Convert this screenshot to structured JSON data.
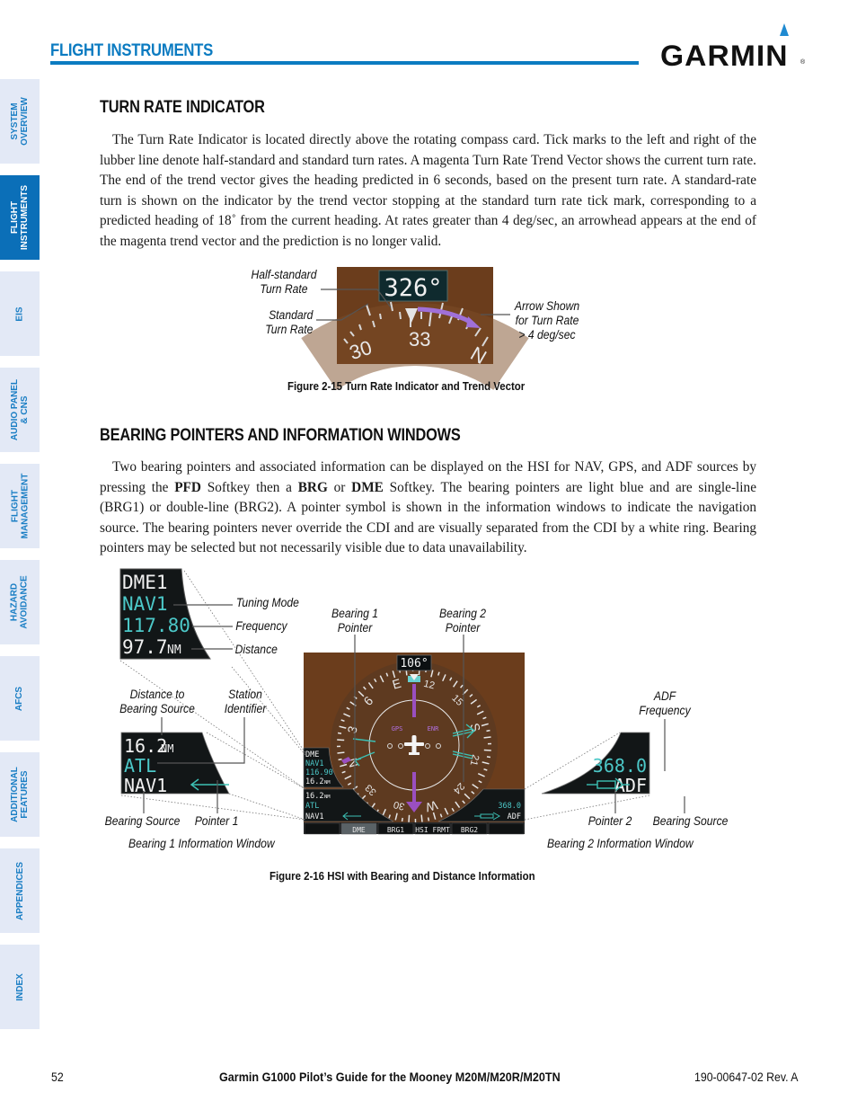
{
  "header": {
    "section_title": "FLIGHT INSTRUMENTS",
    "logo": "GARMIN",
    "logo_mark": "®",
    "accent_color": "#0b7bc1"
  },
  "side_tabs": [
    {
      "label": "SYSTEM\nOVERVIEW",
      "active": false
    },
    {
      "label": "FLIGHT\nINSTRUMENTS",
      "active": true
    },
    {
      "label": "EIS",
      "active": false
    },
    {
      "label": "AUDIO PANEL\n& CNS",
      "active": false
    },
    {
      "label": "FLIGHT\nMANAGEMENT",
      "active": false
    },
    {
      "label": "HAZARD\nAVOIDANCE",
      "active": false
    },
    {
      "label": "AFCS",
      "active": false
    },
    {
      "label": "ADDITIONAL\nFEATURES",
      "active": false
    },
    {
      "label": "APPENDICES",
      "active": false
    },
    {
      "label": "INDEX",
      "active": false
    }
  ],
  "section1": {
    "heading": "TURN RATE INDICATOR",
    "body": "The Turn Rate Indicator is located directly above the rotating compass card.  Tick marks to the left and right of the lubber line denote half-standard and standard turn rates.  A magenta Turn Rate Trend Vector shows the current turn rate.  The end of the trend vector gives the heading predicted in 6 seconds, based on the present turn rate.  A standard-rate turn is shown on the indicator by the trend vector stopping at the standard turn rate tick mark, corresponding to a predicted heading of 18˚ from the current heading.  At rates greater than 4 deg/sec, an arrowhead appears at the end of the magenta trend vector and the prediction is no longer valid.",
    "figure": {
      "caption": "Figure 2-15  Turn Rate Indicator and Trend Vector",
      "heading_readout": "326°",
      "card_labels": [
        "30",
        "33",
        "N"
      ],
      "callouts": {
        "half_standard_1": "Half-standard",
        "half_standard_2": "Turn Rate",
        "standard_1": "Standard",
        "standard_2": "Turn Rate",
        "arrow_1": "Arrow Shown",
        "arrow_2": "for Turn Rate",
        "arrow_3": "> 4 deg/sec"
      }
    }
  },
  "section2": {
    "heading": "BEARING POINTERS AND INFORMATION WINDOWS",
    "body_parts": {
      "p1": "Two bearing pointers and associated information can be displayed on the HSI for NAV, GPS, and ADF sources by pressing the ",
      "b1": "PFD",
      "p2": " Softkey then a ",
      "b2": "BRG",
      "p3": " or ",
      "b3": "DME",
      "p4": " Softkey.  The bearing pointers are light blue and are single-line (BRG1) or double-line (BRG2).  A pointer symbol is shown in the information windows to indicate the navigation source.  The bearing pointers never override the CDI and are visually separated from the CDI by a white ring.  Bearing pointers may be selected but not necessarily visible due to data unavailability."
    },
    "figure": {
      "caption": "Figure 2-16  HSI with Bearing and Distance Information",
      "dme_window": {
        "mode": "DME1",
        "source": "NAV1",
        "frequency": "117.80",
        "distance": "97.7",
        "unit": "NM"
      },
      "dme_callouts": {
        "tuning_mode": "Tuning Mode",
        "frequency": "Frequency",
        "distance": "Distance"
      },
      "hsi": {
        "heading": "106°",
        "nav_source": "GPS",
        "phase": "ENR",
        "card_labels": [
          "E",
          "12",
          "15",
          "S",
          "21",
          "24",
          "W",
          "30",
          "33",
          "N",
          "3",
          "6"
        ],
        "dme_box": {
          "mode": "DME",
          "source": "NAV1",
          "frequency": "116.90",
          "distance": "16.2",
          "unit": "NM"
        },
        "brg1_box": {
          "distance": "16.2",
          "unit": "NM",
          "ident": "ATL",
          "source": "NAV1"
        },
        "brg2_box": {
          "frequency": "368.0",
          "source": "ADF"
        },
        "softkeys": [
          "",
          "DME",
          "BRG1",
          "HSI FRMT",
          "BRG2",
          ""
        ]
      },
      "callouts": {
        "bearing1_pointer_1": "Bearing 1",
        "bearing1_pointer_2": "Pointer",
        "bearing2_pointer_1": "Bearing 2",
        "bearing2_pointer_2": "Pointer",
        "distance_to_1": "Distance to",
        "distance_to_2": "Bearing Source",
        "station_id_1": "Station",
        "station_id_2": "Identifier",
        "adf_freq_1": "ADF",
        "adf_freq_2": "Frequency",
        "bearing_source_left": "Bearing Source",
        "pointer1": "Pointer 1",
        "pointer2": "Pointer 2",
        "bearing_source_right": "Bearing Source",
        "brg1_window": "Bearing 1 Information Window",
        "brg2_window": "Bearing 2 Information Window"
      },
      "brg1_window": {
        "distance": "16.2",
        "unit": "NM",
        "ident": "ATL",
        "source": "NAV1"
      },
      "brg2_window": {
        "frequency": "368.0",
        "source": "ADF"
      }
    }
  },
  "footer": {
    "page_number": "52",
    "title": "Garmin G1000 Pilot’s Guide for the Mooney M20M/M20R/M20TN",
    "doc_number": "190-00647-02  Rev. A"
  }
}
